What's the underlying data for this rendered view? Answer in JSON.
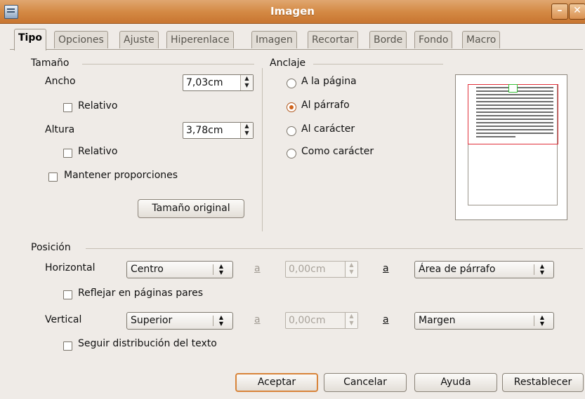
{
  "window": {
    "title": "Imagen"
  },
  "tabs": [
    {
      "label": "Tipo",
      "active": true
    },
    {
      "label": "Opciones"
    },
    {
      "label": "Ajuste"
    },
    {
      "label": "Hiperenlace"
    },
    {
      "label": "Imagen"
    },
    {
      "label": "Recortar"
    },
    {
      "label": "Borde"
    },
    {
      "label": "Fondo"
    },
    {
      "label": "Macro"
    }
  ],
  "size": {
    "heading": "Tamaño",
    "width_label": "Ancho",
    "width_value": "7,03cm",
    "width_relative": "Relativo",
    "height_label": "Altura",
    "height_value": "3,78cm",
    "height_relative": "Relativo",
    "keep_ratio": "Mantener proporciones",
    "original_size_button": "Tamaño original"
  },
  "anchor": {
    "heading": "Anclaje",
    "options": [
      {
        "label": "A la página",
        "selected": false
      },
      {
        "label": "Al párrafo",
        "selected": true
      },
      {
        "label": "Al carácter",
        "selected": false
      },
      {
        "label": "Como carácter",
        "selected": false
      }
    ]
  },
  "position": {
    "heading": "Posición",
    "horizontal_label": "Horizontal",
    "horizontal_value": "Centro",
    "horizontal_by_label": "a",
    "horizontal_by_value": "0,00cm",
    "horizontal_to_label": "a",
    "horizontal_to_value": "Área de párrafo",
    "mirror_label": "Reflejar en páginas pares",
    "vertical_label": "Vertical",
    "vertical_value": "Superior",
    "vertical_by_label": "a",
    "vertical_by_value": "0,00cm",
    "vertical_to_label": "a",
    "vertical_to_value": "Margen",
    "follow_flow_label": "Seguir distribución del texto"
  },
  "buttons": {
    "ok": "Aceptar",
    "cancel": "Cancelar",
    "help": "Ayuda",
    "reset": "Restablecer"
  },
  "colors": {
    "titlebar": "#d48a45",
    "default_button_border": "#d8843a",
    "radio_selected": "#d0641c",
    "preview_paragraph_frame": "#e0303a",
    "preview_anchor_marker": "#38c038"
  }
}
